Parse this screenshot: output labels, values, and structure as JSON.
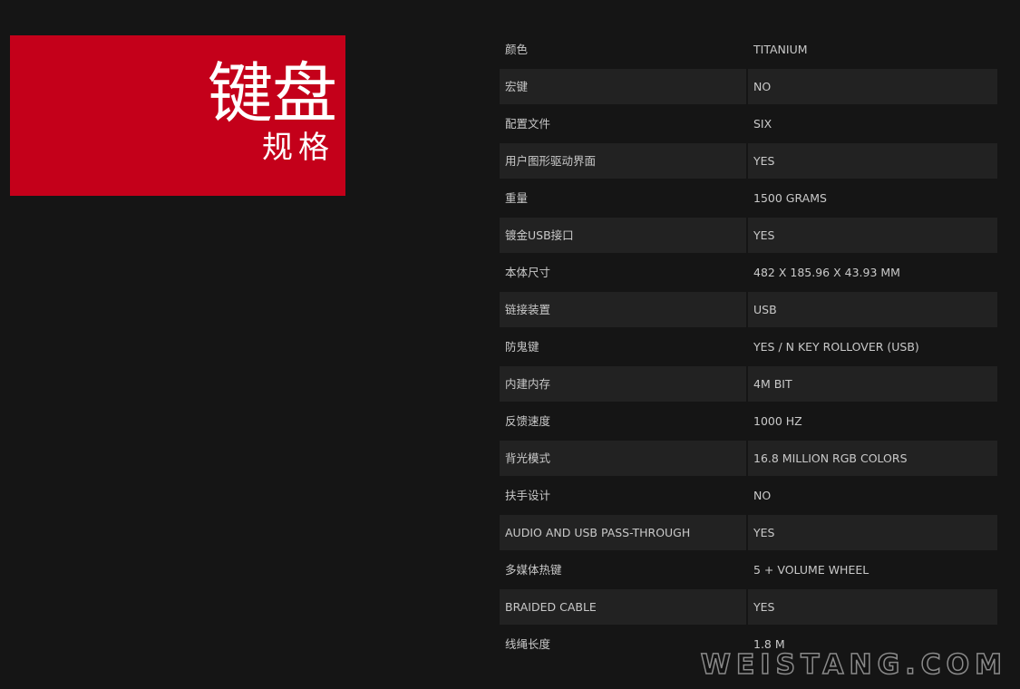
{
  "header": {
    "title": "键盘",
    "subtitle": "规格"
  },
  "specs": [
    {
      "label": "颜色",
      "value": "TITANIUM"
    },
    {
      "label": "宏键",
      "value": "NO"
    },
    {
      "label": "配置文件",
      "value": "SIX"
    },
    {
      "label": "用户图形驱动界面",
      "value": "YES"
    },
    {
      "label": "重量",
      "value": "1500 GRAMS"
    },
    {
      "label": "镀金USB接口",
      "value": "YES"
    },
    {
      "label": "本体尺寸",
      "value": "482 X 185.96 X 43.93 MM"
    },
    {
      "label": "链接装置",
      "value": "USB"
    },
    {
      "label": "防鬼键",
      "value": "YES / N KEY ROLLOVER (USB)"
    },
    {
      "label": "内建内存",
      "value": "4M BIT"
    },
    {
      "label": "反馈速度",
      "value": "1000 HZ"
    },
    {
      "label": "背光模式",
      "value": "16.8 MILLION RGB COLORS"
    },
    {
      "label": "扶手设计",
      "value": "NO"
    },
    {
      "label": "AUDIO AND USB PASS-THROUGH",
      "value": "YES"
    },
    {
      "label": "多媒体热键",
      "value": "5 + VOLUME WHEEL"
    },
    {
      "label": "BRAIDED CABLE",
      "value": "YES"
    },
    {
      "label": "线绳长度",
      "value": "1.8 M"
    }
  ],
  "watermark": "WEISTANG.COM",
  "colors": {
    "background": "#151515",
    "accent": "#c4001a",
    "row_shade": "#222222",
    "text": "#c9c9c9"
  }
}
